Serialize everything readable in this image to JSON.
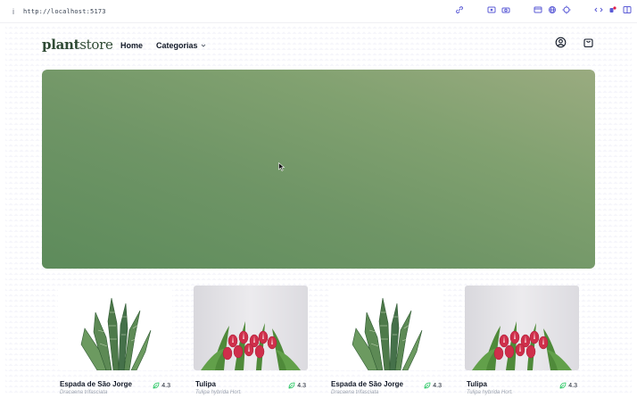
{
  "browser": {
    "info_glyph": "i",
    "url": "http://localhost:5173",
    "toolbar_icons": [
      "link-icon",
      "screen-record-icon",
      "camera-icon",
      "panel-icon",
      "globe-icon",
      "target-icon",
      "code-icon",
      "extension-icon",
      "sidebar-icon"
    ]
  },
  "header": {
    "logo_part1": "plant",
    "logo_part2": "store",
    "nav": {
      "home": "Home",
      "categories": "Categorias"
    },
    "icons": [
      "user-icon",
      "shopping-bag-icon"
    ]
  },
  "hero": {
    "colors": [
      "#9aab80",
      "#81a170",
      "#6f9566",
      "#5d8b5b"
    ]
  },
  "products": [
    {
      "name": "Espada de São Jorge",
      "latin": "Dracaena trifasciata",
      "rating": "4.3",
      "image": "snake-plant"
    },
    {
      "name": "Tulipa",
      "latin": "Tulipa hybrida Hort.",
      "rating": "4.3",
      "image": "tulip"
    },
    {
      "name": "Espada de São Jorge",
      "latin": "Dracaena trifasciata",
      "rating": "4.3",
      "image": "snake-plant"
    },
    {
      "name": "Tulipa",
      "latin": "Tulipa hybrida Hort.",
      "rating": "4.3",
      "image": "tulip"
    }
  ],
  "colors": {
    "brand": "#2f4a34",
    "rating_leaf": "#22c55e"
  }
}
